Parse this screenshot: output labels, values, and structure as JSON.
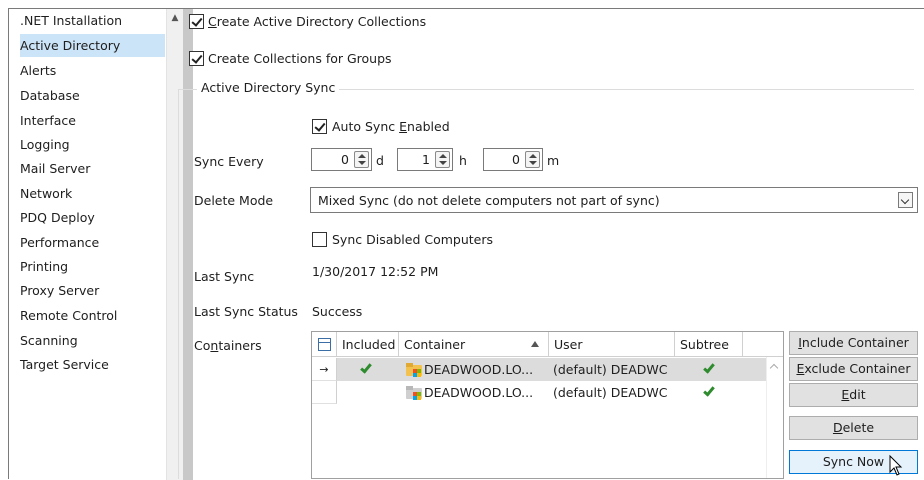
{
  "sidebar": {
    "items": [
      {
        "label": ".NET Installation"
      },
      {
        "label": "Active Directory"
      },
      {
        "label": "Alerts"
      },
      {
        "label": "Database"
      },
      {
        "label": "Interface"
      },
      {
        "label": "Logging"
      },
      {
        "label": "Mail Server"
      },
      {
        "label": "Network"
      },
      {
        "label": "PDQ Deploy"
      },
      {
        "label": "Performance"
      },
      {
        "label": "Printing"
      },
      {
        "label": "Proxy Server"
      },
      {
        "label": "Remote Control"
      },
      {
        "label": "Scanning"
      },
      {
        "label": "Target Service"
      }
    ],
    "selected": "Active Directory"
  },
  "settings": {
    "create_ad_collections": {
      "label_pre": "",
      "label_key": "C",
      "label_post": "reate Active Directory Collections",
      "checked": true
    },
    "create_group_collections": {
      "label": "Create Collections for Groups",
      "checked": true
    },
    "sync_group": {
      "title": "Active Directory Sync",
      "auto_sync": {
        "label_pre": "Auto Sync ",
        "label_key": "E",
        "label_post": "nabled",
        "checked": true
      },
      "sync_every": {
        "label": "Sync Every",
        "days": "0",
        "days_unit": "d",
        "hours": "1",
        "hours_unit": "h",
        "minutes": "0",
        "minutes_unit": "m"
      },
      "delete_mode": {
        "label": "Delete Mode",
        "value": "Mixed Sync (do not delete computers not part of sync)"
      },
      "sync_disabled": {
        "label": "Sync Disabled Computers",
        "checked": false
      },
      "last_sync": {
        "label": "Last Sync",
        "value": "1/30/2017 12:52 PM"
      },
      "last_sync_status": {
        "label": "Last Sync Status",
        "value": "Success"
      },
      "containers": {
        "label_pre": "Co",
        "label_key": "n",
        "label_post": "tainers"
      }
    }
  },
  "grid": {
    "columns": {
      "included": "Included",
      "container": "Container",
      "user": "User",
      "subtree": "Subtree"
    },
    "sort_column": "Container",
    "sort_direction": "ascending",
    "rows": [
      {
        "marker": "→",
        "included": true,
        "container": "DEADWOOD.LO...",
        "user": "(default) DEADWC",
        "subtree": true,
        "selected": true
      },
      {
        "marker": "",
        "included": false,
        "container": "DEADWOOD.LO...",
        "user": "(default) DEADWC",
        "subtree": true,
        "selected": false
      }
    ]
  },
  "buttons": {
    "include": {
      "key": "I",
      "rest": "nclude Container"
    },
    "exclude": {
      "key": "E",
      "rest": "xclude Container"
    },
    "edit": {
      "key": "E",
      "rest": "dit"
    },
    "delete": {
      "key": "D",
      "rest": "elete"
    },
    "sync_now": {
      "label": "Sync Now"
    }
  },
  "colors": {
    "selection": "#cce4f7",
    "check_green": "#2e8b2e",
    "focus_border": "#0078d7"
  }
}
